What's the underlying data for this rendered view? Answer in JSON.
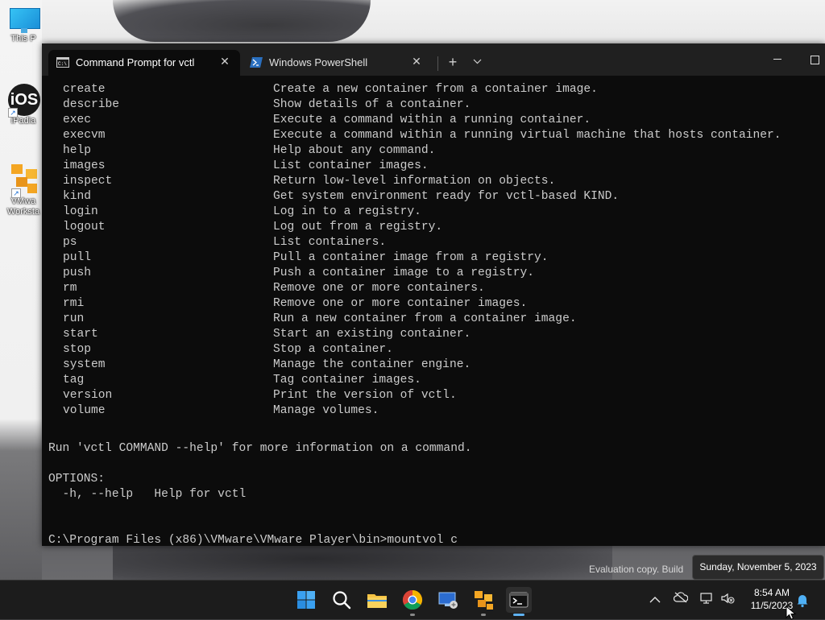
{
  "desktop": {
    "icons": [
      {
        "label": "This P",
        "icon": "monitor-icon"
      },
      {
        "label": "iPadia",
        "icon": "ios-app-icon"
      },
      {
        "label": "VMwa",
        "label2": "Worksta",
        "icon": "vmware-workstation-icon"
      }
    ],
    "watermark": "Evaluation copy. Build"
  },
  "window": {
    "tabs": [
      {
        "title": "Command Prompt for vctl",
        "icon": "cmd-icon",
        "active": true
      },
      {
        "title": "Windows PowerShell",
        "icon": "powershell-icon",
        "active": false
      }
    ],
    "new_tab_symbol": "+",
    "dropdown_symbol": "⌄",
    "close_symbol": "✕"
  },
  "console": {
    "commands": [
      {
        "name": "create",
        "desc": "Create a new container from a container image."
      },
      {
        "name": "describe",
        "desc": "Show details of a container."
      },
      {
        "name": "exec",
        "desc": "Execute a command within a running container."
      },
      {
        "name": "execvm",
        "desc": "Execute a command within a running virtual machine that hosts container."
      },
      {
        "name": "help",
        "desc": "Help about any command."
      },
      {
        "name": "images",
        "desc": "List container images."
      },
      {
        "name": "inspect",
        "desc": "Return low-level information on objects."
      },
      {
        "name": "kind",
        "desc": "Get system environment ready for vctl-based KIND."
      },
      {
        "name": "login",
        "desc": "Log in to a registry."
      },
      {
        "name": "logout",
        "desc": "Log out from a registry."
      },
      {
        "name": "ps",
        "desc": "List containers."
      },
      {
        "name": "pull",
        "desc": "Pull a container image from a registry."
      },
      {
        "name": "push",
        "desc": "Push a container image to a registry."
      },
      {
        "name": "rm",
        "desc": "Remove one or more containers."
      },
      {
        "name": "rmi",
        "desc": "Remove one or more container images."
      },
      {
        "name": "run",
        "desc": "Run a new container from a container image."
      },
      {
        "name": "start",
        "desc": "Start an existing container."
      },
      {
        "name": "stop",
        "desc": "Stop a container."
      },
      {
        "name": "system",
        "desc": "Manage the container engine."
      },
      {
        "name": "tag",
        "desc": "Tag container images."
      },
      {
        "name": "version",
        "desc": "Print the version of vctl."
      },
      {
        "name": "volume",
        "desc": "Manage volumes."
      }
    ],
    "help_hint": "Run 'vctl COMMAND --help' for more information on a command.",
    "options_header": "OPTIONS:",
    "options_line": "  -h, --help   Help for vctl",
    "prompt": "C:\\Program Files (x86)\\VMware\\VMware Player\\bin>",
    "input": "mountvol c"
  },
  "tooltip": {
    "date_full": "Sunday, November 5, 2023"
  },
  "taskbar": {
    "items": [
      "windows-start-icon",
      "search-icon",
      "file-explorer-icon",
      "chrome-icon",
      "remote-desktop-icon",
      "vmware-icon",
      "terminal-icon"
    ],
    "time": "8:54 AM",
    "date": "11/5/2023",
    "tray_icons": [
      "chevron-up-icon",
      "onedrive-icon",
      "network-icon",
      "volume-muted-icon",
      "notification-bell-icon"
    ]
  },
  "colors": {
    "terminal_bg": "#0c0c0c",
    "terminal_fg": "#cccccc",
    "titlebar_bg": "#202020",
    "taskbar_bg": "#1c1c1c",
    "accent": "#5fb2f2"
  }
}
